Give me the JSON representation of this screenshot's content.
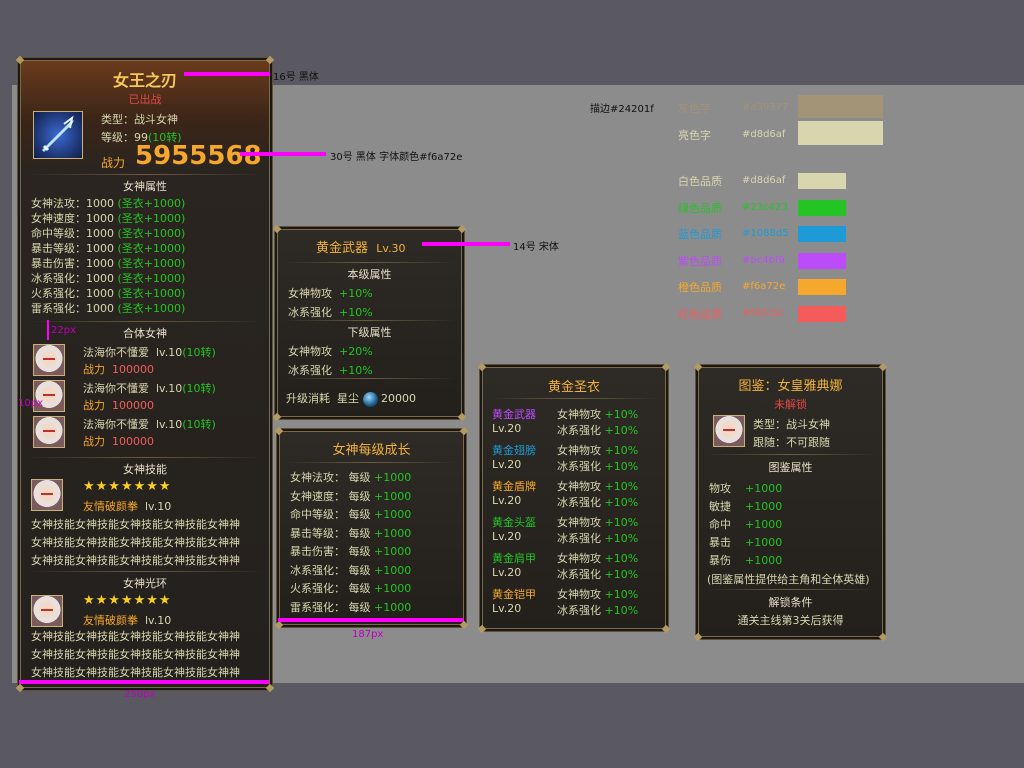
{
  "left_panel": {
    "title": "女王之刃",
    "status": "已出战",
    "type_label": "类型：战斗女神",
    "level_label": "等级：99",
    "level_extra": "(10转)",
    "power_label": "战力",
    "power_value": "5955568",
    "attr_title": "女神属性",
    "attrs": [
      {
        "name": "女神法攻：1000",
        "bonus": "(圣衣+1000)"
      },
      {
        "name": "女神速度：1000",
        "bonus": "(圣衣+1000)"
      },
      {
        "name": "命中等级：1000",
        "bonus": "(圣衣+1000)"
      },
      {
        "name": "暴击等级：1000",
        "bonus": "(圣衣+1000)"
      },
      {
        "name": "暴击伤害：1000",
        "bonus": "(圣衣+1000)"
      },
      {
        "name": "冰系强化：1000",
        "bonus": "(圣衣+1000)"
      },
      {
        "name": "火系强化：1000",
        "bonus": "(圣衣+1000)"
      },
      {
        "name": "雷系强化：1000",
        "bonus": "(圣衣+1000)"
      }
    ],
    "combine_title": "合体女神",
    "combine": [
      {
        "name": "法海你不懂爱",
        "lv": "lv.10",
        "turn": "(10转)",
        "power_label": "战力",
        "power": "100000"
      },
      {
        "name": "法海你不懂爱",
        "lv": "lv.10",
        "turn": "(10转)",
        "power_label": "战力",
        "power": "100000"
      },
      {
        "name": "法海你不懂爱",
        "lv": "lv.10",
        "turn": "(10转)",
        "power_label": "战力",
        "power": "100000"
      }
    ],
    "skill_title": "女神技能",
    "skill_stars": "★★★★★★★",
    "skill_name": "友情破颜拳",
    "skill_lv": "lv.10",
    "skill_desc": [
      "女神技能女神技能女神技能女神技能女神神",
      "女神技能女神技能女神技能女神技能女神神",
      "女神技能女神技能女神技能女神技能女神神"
    ],
    "halo_title": "女神光环",
    "halo_stars": "★★★★★★★",
    "halo_name": "友情破颜拳",
    "halo_lv": "lv.10",
    "halo_desc": [
      "女神技能女神技能女神技能女神技能女神神",
      "女神技能女神技能女神技能女神技能女神神",
      "女神技能女神技能女神技能女神技能女神神"
    ]
  },
  "weapon_panel": {
    "title": "黄金武器",
    "lv": "Lv.30",
    "cur_title": "本级属性",
    "cur": [
      {
        "name": "女神物攻",
        "val": "+10%"
      },
      {
        "name": "冰系强化",
        "val": "+10%"
      }
    ],
    "next_title": "下级属性",
    "next": [
      {
        "name": "女神物攻",
        "val": "+20%"
      },
      {
        "name": "冰系强化",
        "val": "+10%"
      }
    ],
    "cost_label": "升级消耗",
    "cost_item": "星尘",
    "cost_value": "20000"
  },
  "growth_panel": {
    "title": "女神每级成长",
    "rows": [
      {
        "name": "女神法攻：",
        "per": "每级",
        "val": "+1000"
      },
      {
        "name": "女神速度：",
        "per": "每级",
        "val": "+1000"
      },
      {
        "name": "命中等级：",
        "per": "每级",
        "val": "+1000"
      },
      {
        "name": "暴击等级：",
        "per": "每级",
        "val": "+1000"
      },
      {
        "name": "暴击伤害：",
        "per": "每级",
        "val": "+1000"
      },
      {
        "name": "冰系强化：",
        "per": "每级",
        "val": "+1000"
      },
      {
        "name": "火系强化：",
        "per": "每级",
        "val": "+1000"
      },
      {
        "name": "雷系强化：",
        "per": "每级",
        "val": "+1000"
      }
    ]
  },
  "armor_panel": {
    "title": "黄金圣衣",
    "items": [
      {
        "name": "黄金武器",
        "color": "#bc4bfb",
        "lv": "Lv.20",
        "a1": "女神物攻",
        "v1": "+10%",
        "a2": "冰系强化",
        "v2": "+10%"
      },
      {
        "name": "黄金翅膀",
        "color": "#1e9ad6",
        "lv": "Lv.20",
        "a1": "女神物攻",
        "v1": "+10%",
        "a2": "冰系强化",
        "v2": "+10%"
      },
      {
        "name": "黄金盾牌",
        "color": "#f4a72a",
        "lv": "Lv.20",
        "a1": "女神物攻",
        "v1": "+10%",
        "a2": "冰系强化",
        "v2": "+10%"
      },
      {
        "name": "黄金头盔",
        "color": "#23c423",
        "lv": "Lv.20",
        "a1": "女神物攻",
        "v1": "+10%",
        "a2": "冰系强化",
        "v2": "+10%"
      },
      {
        "name": "黄金肩甲",
        "color": "#23c423",
        "lv": "Lv.20",
        "a1": "女神物攻",
        "v1": "+10%",
        "a2": "冰系强化",
        "v2": "+10%"
      },
      {
        "name": "黄金铠甲",
        "color": "#f4a72a",
        "lv": "Lv.20",
        "a1": "女神物攻",
        "v1": "+10%",
        "a2": "冰系强化",
        "v2": "+10%"
      }
    ]
  },
  "codex_panel": {
    "title": "图鉴：女皇雅典娜",
    "status": "未解锁",
    "type": "类型：战斗女神",
    "follow": "跟随：不可跟随",
    "attr_title": "图鉴属性",
    "attrs": [
      {
        "name": "物攻",
        "val": "+1000"
      },
      {
        "name": "敏捷",
        "val": "+1000"
      },
      {
        "name": "命中",
        "val": "+1000"
      },
      {
        "name": "暴击",
        "val": "+1000"
      },
      {
        "name": "暴伤",
        "val": "+1000"
      }
    ],
    "note": "(图鉴属性提供给主角和全体英雄)",
    "unlock_title": "解锁条件",
    "unlock_text": "通关主线第3关后获得"
  },
  "legend": {
    "border_label": "描边#24201f",
    "gray_label": "灰色字",
    "gray_hex": "#a39377",
    "bright_label": "亮色字",
    "bright_hex": "#d8d6af",
    "white_label": "白色品质",
    "white_hex": "#d8d6af",
    "green_label": "绿色品质",
    "green_hex": "#23c423",
    "blue_label": "蓝色品质",
    "blue_hex": "#1088d5",
    "purple_label": "紫色品质",
    "purple_hex": "#bc4bf9",
    "orange_label": "橙色品质",
    "orange_hex": "#f6a72e",
    "red_label": "红色品质",
    "red_hex": "#f45c5c"
  },
  "annotations": {
    "title_font": "16号  黑体",
    "power_font": "30号  黑体  字体颜色#f6a72e",
    "weapon_font": "14号  宋体",
    "gap_22": "22px",
    "gap_10": "10px",
    "width_187": "187px",
    "width_250": "250px"
  },
  "colors": {
    "gray": "#a39377",
    "bright": "#d8d6af",
    "white_q": "#d8d6af",
    "green": "#23c423",
    "blue": "#1088d5",
    "purple": "#bc4bf9",
    "orange": "#f6a72e",
    "red": "#f45c5c",
    "border": "#24201f"
  },
  "icons": [
    "weapon-icon",
    "goddess-avatar",
    "star-icon",
    "stardust-orb-icon"
  ]
}
